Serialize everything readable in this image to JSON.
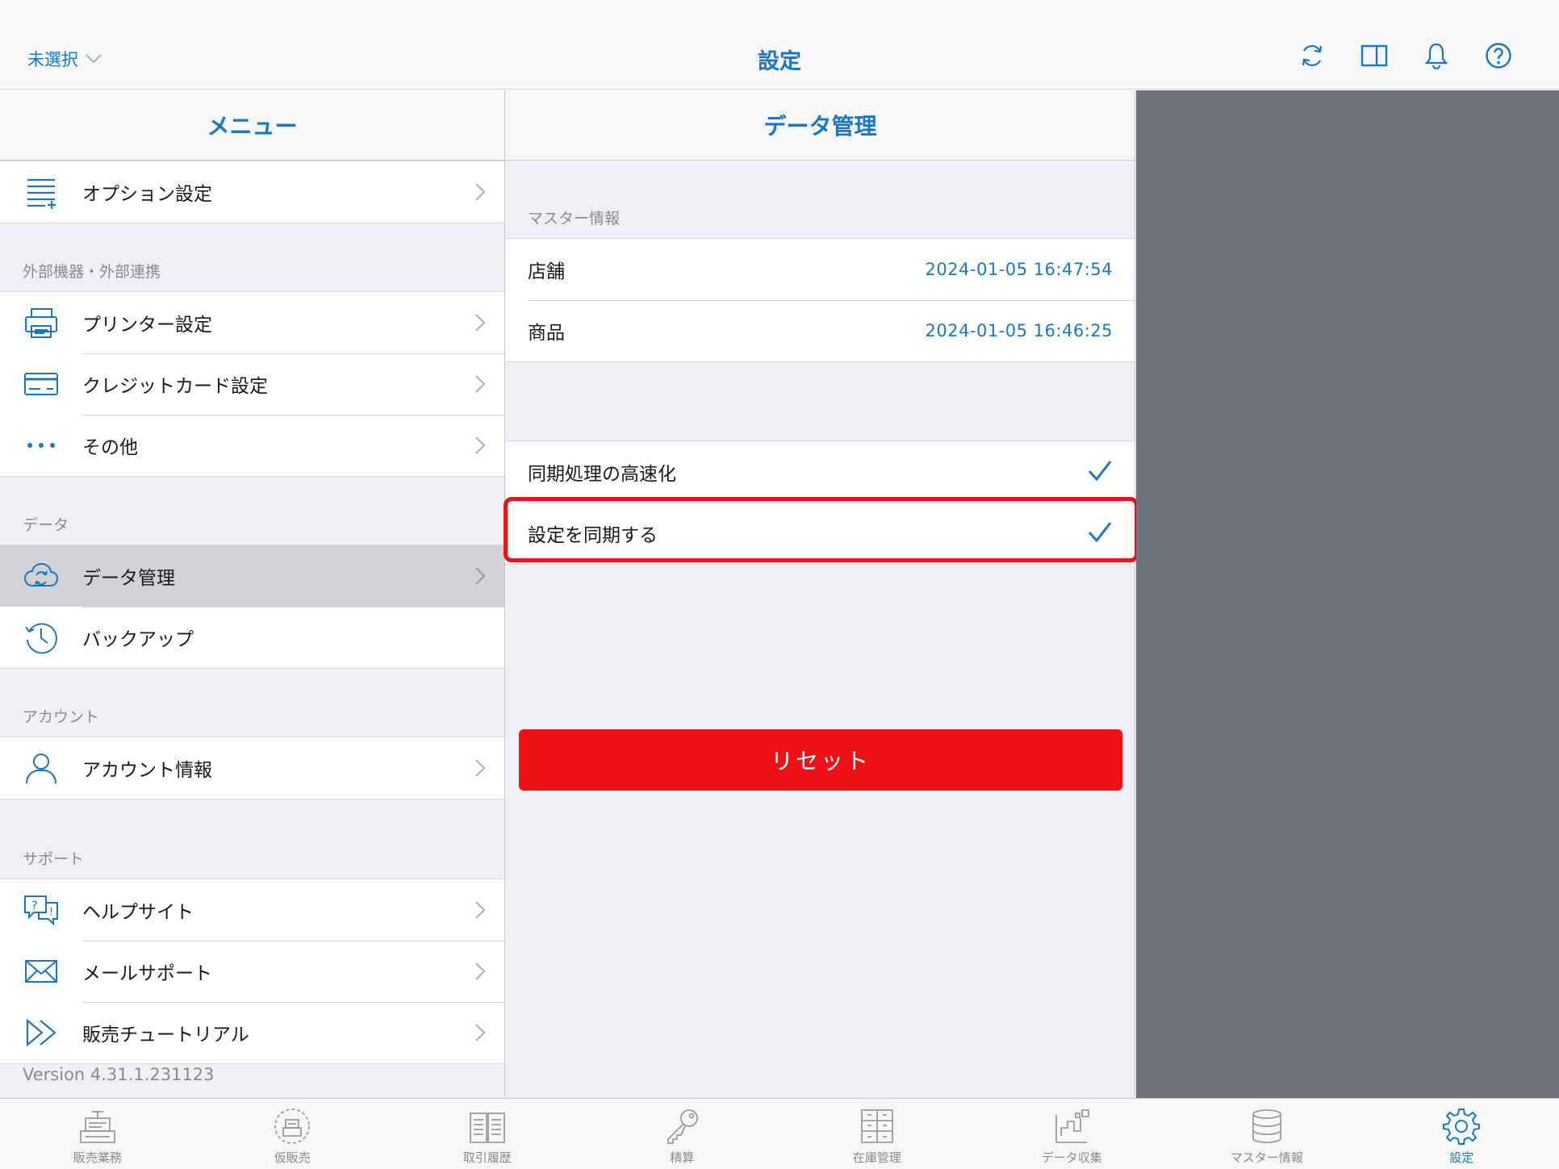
{
  "topbar": {
    "store_select": "未選択",
    "title": "設定",
    "icons": [
      "sync-icon",
      "split-view-icon",
      "bell-icon",
      "help-icon"
    ]
  },
  "menu": {
    "header": "メニュー",
    "option_settings": "オプション設定",
    "section_external": "外部機器・外部連携",
    "printer_settings": "プリンター設定",
    "credit_card_settings": "クレジットカード設定",
    "other": "その他",
    "section_data": "データ",
    "data_management": "データ管理",
    "backup": "バックアップ",
    "section_account": "アカウント",
    "account_info": "アカウント情報",
    "section_support": "サポート",
    "help_site": "ヘルプサイト",
    "mail_support": "メールサポート",
    "sales_tutorial": "販売チュートリアル",
    "version": "Version 4.31.1.231123"
  },
  "detail": {
    "header": "データ管理",
    "section_master": "マスター情報",
    "store_label": "店舗",
    "store_value": "2024-01-05 16:47:54",
    "product_label": "商品",
    "product_value": "2024-01-05 16:46:25",
    "fast_sync_label": "同期処理の高速化",
    "fast_sync_checked": true,
    "sync_settings_label": "設定を同期する",
    "sync_settings_checked": true,
    "reset_button": "リセット"
  },
  "tabbar": {
    "tabs": [
      {
        "label": "販売業務",
        "icon": "register-icon"
      },
      {
        "label": "仮販売",
        "icon": "temp-sale-icon"
      },
      {
        "label": "取引履歴",
        "icon": "history-book-icon"
      },
      {
        "label": "精算",
        "icon": "key-icon"
      },
      {
        "label": "在庫管理",
        "icon": "inventory-icon"
      },
      {
        "label": "データ収集",
        "icon": "data-collection-icon"
      },
      {
        "label": "マスター情報",
        "icon": "database-icon"
      },
      {
        "label": "設定",
        "icon": "gear-icon",
        "active": true
      }
    ]
  },
  "colors": {
    "accent": "#1a78c2",
    "reset": "#ee1216",
    "highlight": "#e8141c",
    "dim_area": "#6f7178"
  }
}
